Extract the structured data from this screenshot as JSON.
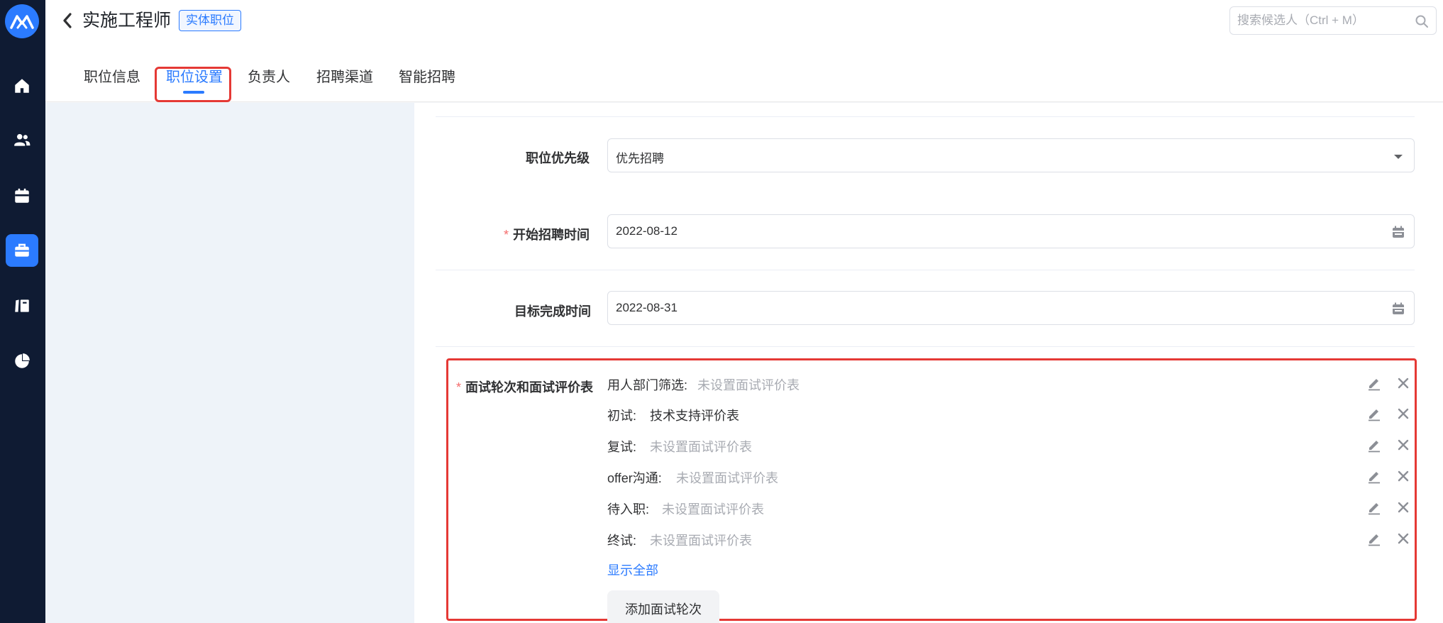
{
  "header": {
    "title": "实施工程师",
    "tag": "实体职位",
    "search_placeholder": "搜索候选人（Ctrl + M）"
  },
  "tabs": [
    {
      "label": "职位信息",
      "active": false
    },
    {
      "label": "职位设置",
      "active": true
    },
    {
      "label": "负责人",
      "active": false
    },
    {
      "label": "招聘渠道",
      "active": false
    },
    {
      "label": "智能招聘",
      "active": false
    }
  ],
  "sidebar": {
    "items": [
      {
        "icon": "home-icon",
        "active": false
      },
      {
        "icon": "users-icon",
        "active": false
      },
      {
        "icon": "calendar-icon",
        "active": false
      },
      {
        "icon": "briefcase-icon",
        "active": true
      },
      {
        "icon": "books-icon",
        "active": false
      },
      {
        "icon": "pie-chart-icon",
        "active": false
      }
    ]
  },
  "form": {
    "priority": {
      "label": "职位优先级",
      "value": "优先招聘"
    },
    "start_date": {
      "required_mark": "*",
      "label": "开始招聘时间",
      "value": "2022-08-12"
    },
    "target_date": {
      "label": "目标完成时间",
      "value": "2022-08-31"
    },
    "interview": {
      "required_mark": "*",
      "label": "面试轮次和面试评价表",
      "rounds": [
        {
          "name": "用人部门筛选:",
          "form": "未设置面试评价表",
          "set": false
        },
        {
          "name": "初试:",
          "form": "技术支持评价表",
          "set": true
        },
        {
          "name": "复试:",
          "form": "未设置面试评价表",
          "set": false
        },
        {
          "name": "offer沟通:",
          "form": "未设置面试评价表",
          "set": false
        },
        {
          "name": "待入职:",
          "form": "未设置面试评价表",
          "set": false
        },
        {
          "name": "终试:",
          "form": "未设置面试评价表",
          "set": false
        }
      ],
      "show_all": "显示全部",
      "add_button": "添加面试轮次"
    }
  },
  "colors": {
    "accent": "#2b7bff",
    "sidebar_bg": "#0f1b33",
    "highlight": "#e53935",
    "required": "#f56c6c"
  }
}
